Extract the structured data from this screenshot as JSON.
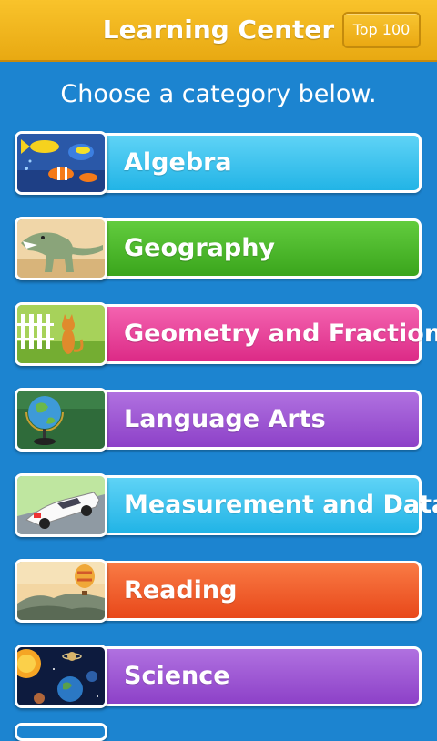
{
  "header": {
    "title": "Learning Center",
    "top_button": "Top 100"
  },
  "subtitle": "Choose a category below.",
  "categories": [
    {
      "label": "Algebra",
      "color": "#2fc1ee",
      "icon": "tropical-fish-icon"
    },
    {
      "label": "Geography",
      "color": "#45b524",
      "icon": "dinosaur-icon"
    },
    {
      "label": "Geometry and Fractions",
      "color": "#ea3c98",
      "icon": "cat-fence-icon"
    },
    {
      "label": "Language Arts",
      "color": "#9b55cf",
      "icon": "globe-icon"
    },
    {
      "label": "Measurement and Data",
      "color": "#2fc1ee",
      "icon": "race-car-icon"
    },
    {
      "label": "Reading",
      "color": "#f25d2a",
      "icon": "hot-air-balloon-icon"
    },
    {
      "label": "Science",
      "color": "#9b55cf",
      "icon": "solar-system-icon"
    }
  ]
}
